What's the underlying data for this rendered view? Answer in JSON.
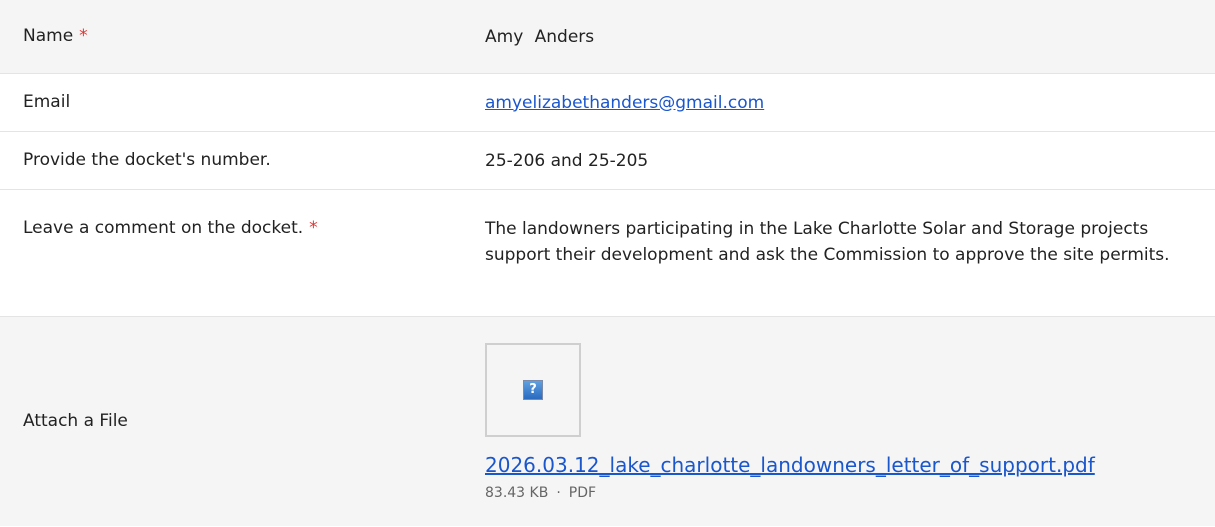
{
  "fields": [
    {
      "label": "Name",
      "required": "*",
      "value": "Amy  Anders"
    },
    {
      "label": "Email",
      "value": "amyelizabethanders@gmail.com"
    },
    {
      "label": "Provide the docket's number.",
      "value": "25-206 and 25-205"
    },
    {
      "label": "Leave a comment on the docket.",
      "required": "*",
      "value": "The landowners participating in the Lake Charlotte Solar and Storage projects support their development and ask the Commission to approve the site permits."
    },
    {
      "label": "Attach a File"
    }
  ],
  "attachment": {
    "filename": "2026.03.12_lake_charlotte_landowners_letter_of_support.pdf",
    "size": "83.43 KB",
    "separator": "·",
    "type": "PDF",
    "thumbnail_icon": "broken-image-icon"
  },
  "colors": {
    "required": "#e0332f",
    "link": "#1a56cc",
    "shaded_row": "#f5f5f5"
  }
}
